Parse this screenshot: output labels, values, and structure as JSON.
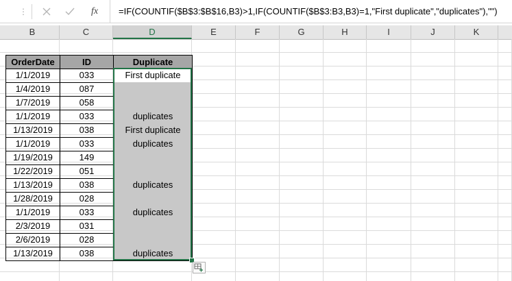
{
  "formula_bar": {
    "cancel_icon": "close-icon",
    "enter_icon": "check-icon",
    "fx_label": "fx",
    "formula": "=IF(COUNTIF($B$3:$B$16,B3)>1,IF(COUNTIF($B$3:B3,B3)=1,\"First duplicate\",\"duplicates\"),\"\")"
  },
  "columns": [
    "B",
    "C",
    "D",
    "E",
    "F",
    "G",
    "H",
    "I",
    "J",
    "K"
  ],
  "selected_column": "D",
  "table": {
    "headers": [
      "OrderDate",
      "ID",
      "Duplicate"
    ],
    "rows": [
      {
        "date": "1/1/2019",
        "id": "033",
        "dup": "First duplicate"
      },
      {
        "date": "1/4/2019",
        "id": "087",
        "dup": ""
      },
      {
        "date": "1/7/2019",
        "id": "058",
        "dup": ""
      },
      {
        "date": "1/1/2019",
        "id": "033",
        "dup": "duplicates"
      },
      {
        "date": "1/13/2019",
        "id": "038",
        "dup": "First duplicate"
      },
      {
        "date": "1/1/2019",
        "id": "033",
        "dup": "duplicates"
      },
      {
        "date": "1/19/2019",
        "id": "149",
        "dup": ""
      },
      {
        "date": "1/22/2019",
        "id": "051",
        "dup": ""
      },
      {
        "date": "1/13/2019",
        "id": "038",
        "dup": "duplicates"
      },
      {
        "date": "1/28/2019",
        "id": "028",
        "dup": ""
      },
      {
        "date": "1/1/2019",
        "id": "033",
        "dup": "duplicates"
      },
      {
        "date": "2/3/2019",
        "id": "031",
        "dup": ""
      },
      {
        "date": "2/6/2019",
        "id": "028",
        "dup": ""
      },
      {
        "date": "1/13/2019",
        "id": "038",
        "dup": "duplicates"
      }
    ]
  },
  "colors": {
    "accent": "#217346",
    "header_fill": "#a6a6a6",
    "result_fill": "#c8c8c8"
  },
  "quick_analysis_icon": "quick-analysis-icon"
}
